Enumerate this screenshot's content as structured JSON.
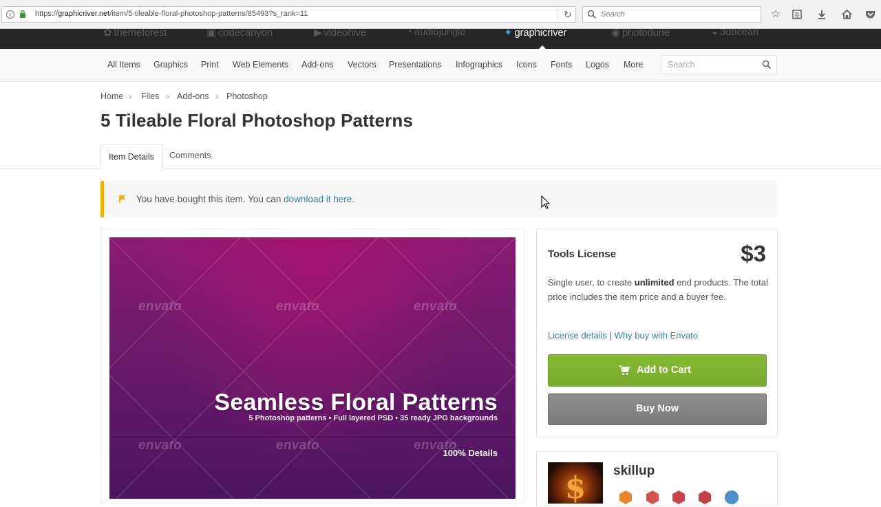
{
  "browser": {
    "url_prefix": "https://",
    "url_host": "graphicriver.net",
    "url_path": "/item/5-tileable-floral-photoshop-patterns/85493?s_rank=11",
    "search_placeholder": "Search"
  },
  "markets": [
    {
      "name": "themeforest",
      "active": false
    },
    {
      "name": "codecanyon",
      "active": false
    },
    {
      "name": "videohive",
      "active": false
    },
    {
      "name": "audiojungle",
      "active": false
    },
    {
      "name": "graphicriver",
      "active": true
    },
    {
      "name": "photodune",
      "active": false
    },
    {
      "name": "3docean",
      "active": false
    }
  ],
  "categories": [
    "All Items",
    "Graphics",
    "Print",
    "Web Elements",
    "Add-ons",
    "Vectors",
    "Presentations",
    "Infographics",
    "Icons",
    "Fonts",
    "Logos",
    "More"
  ],
  "category_search_placeholder": "Search",
  "breadcrumb": [
    "Home",
    "Files",
    "Add-ons",
    "Photoshop"
  ],
  "title": "5 Tileable Floral Photoshop Patterns",
  "tabs": {
    "active": "Item Details",
    "other": "Comments"
  },
  "notice": {
    "text": "You have bought this item. You can ",
    "link": "download it here",
    "end": "."
  },
  "preview": {
    "watermark": "envato",
    "title": "Seamless Floral Patterns",
    "subtitle": "5 Photoshop patterns • Full layered PSD • 35 ready JPG backgrounds",
    "detail": "100% Details"
  },
  "purchase": {
    "license": "Tools License",
    "price": "$3",
    "desc_before": "Single user, to create ",
    "desc_bold": "unlimited",
    "desc_after": " end products. The total price includes the item price and a buyer fee.",
    "link_details": "License details",
    "link_sep": "|",
    "link_why": "Why buy with Envato",
    "add_to_cart": "Add to Cart",
    "buy_now": "Buy Now"
  },
  "author": {
    "name": "skillup"
  },
  "colors": {
    "accent_green": "#7fb231",
    "link_blue": "#2f80a6",
    "notice_yellow": "#f2b200"
  }
}
